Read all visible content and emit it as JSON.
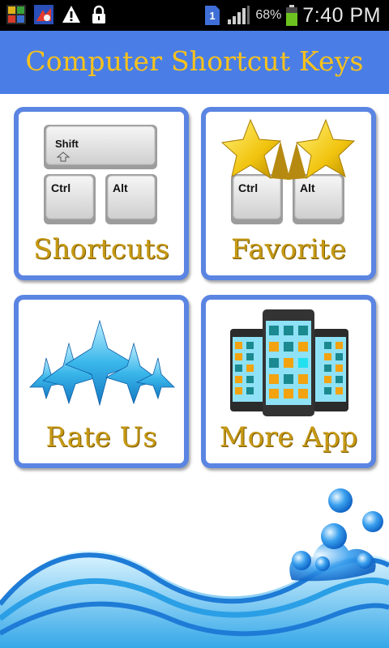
{
  "status_bar": {
    "icons": [
      "kingroot-app-icon",
      "image-app-icon",
      "warning-icon",
      "lock-icon"
    ],
    "sim_badge": "1",
    "battery_percent": "68%",
    "time": "7:40 PM"
  },
  "header": {
    "title": "Computer Shortcut Keys",
    "color": "#4a7ee6",
    "title_color": "#f8c21c"
  },
  "tiles": [
    {
      "label": "Shortcuts",
      "icon": "keyboard-keys-icon",
      "keys": [
        "Shift",
        "Ctrl",
        "Alt"
      ]
    },
    {
      "label": "Favorite",
      "icon": "stars-keys-icon",
      "keys": [
        "Ctrl",
        "Alt"
      ]
    },
    {
      "label": "Rate Us",
      "icon": "blue-stars-icon"
    },
    {
      "label": "More App",
      "icon": "phones-icon"
    }
  ],
  "colors": {
    "tile_border": "#5b85e2",
    "label": "#c79a14"
  }
}
